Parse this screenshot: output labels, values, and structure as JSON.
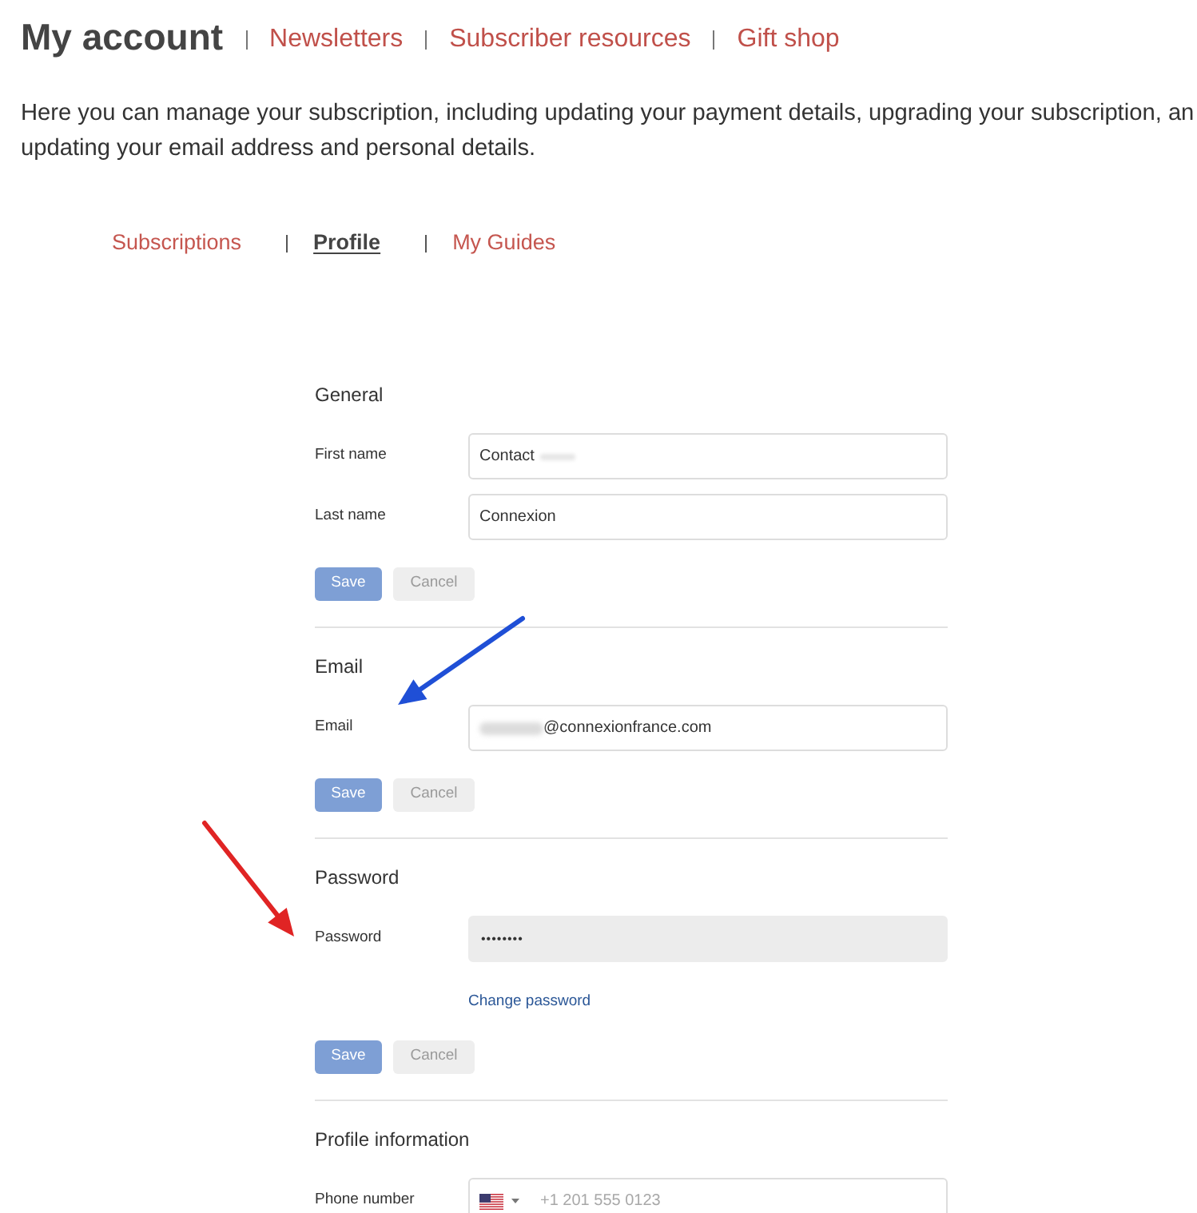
{
  "header": {
    "title": "My account",
    "nav_links": [
      "Newsletters",
      "Subscriber resources",
      "Gift shop"
    ]
  },
  "intro": {
    "lines": [
      "Here you can manage your subscription, including updating your payment details, upgrading your subscription, an",
      "updating your email address and personal details."
    ]
  },
  "tabs": [
    {
      "label": "Subscriptions",
      "selected": false
    },
    {
      "label": "Profile",
      "selected": true
    },
    {
      "label": "My Guides",
      "selected": false
    }
  ],
  "sections": [
    {
      "title": "General",
      "fields": [
        {
          "kind": "text",
          "label": "First name",
          "value": "Contact",
          "redacted_after": true
        },
        {
          "kind": "text",
          "label": "Last name",
          "value": "Connexion"
        }
      ],
      "buttons": [
        {
          "kind": "save",
          "label": "Save",
          "disabled": true
        },
        {
          "kind": "cancel",
          "label": "Cancel",
          "disabled": true
        }
      ]
    },
    {
      "title": "Email",
      "fields": [
        {
          "kind": "text",
          "label": "Email",
          "value": "@connexionfrance.com",
          "redacted_before": true
        }
      ],
      "buttons": [
        {
          "kind": "save",
          "label": "Save",
          "disabled": true
        },
        {
          "kind": "cancel",
          "label": "Cancel",
          "disabled": true
        }
      ]
    },
    {
      "title": "Password",
      "fields": [
        {
          "kind": "password",
          "label": "Password",
          "value": "••••••••",
          "readonly": true
        }
      ],
      "link": "Change password",
      "buttons": [
        {
          "kind": "save",
          "label": "Save",
          "disabled": true
        },
        {
          "kind": "cancel",
          "label": "Cancel",
          "disabled": true
        }
      ]
    },
    {
      "title": "Profile information",
      "fields": [
        {
          "kind": "phone",
          "label": "Phone number",
          "placeholder": "+1 201 555 0123"
        }
      ]
    }
  ],
  "annotations": [
    {
      "kind": "arrow",
      "color": "#1f4fd6"
    },
    {
      "kind": "arrow",
      "color": "#e02424"
    }
  ]
}
